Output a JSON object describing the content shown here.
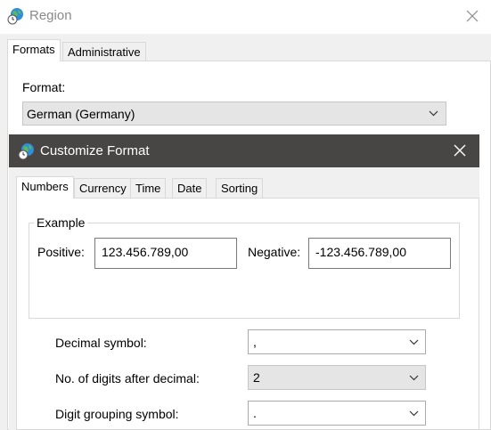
{
  "region": {
    "title": "Region",
    "tabs": [
      {
        "label": "Formats",
        "active": true
      },
      {
        "label": "Administrative",
        "active": false
      }
    ],
    "format_label": "Format:",
    "format_value": "German (Germany)"
  },
  "customize": {
    "title": "Customize Format",
    "tabs": [
      {
        "label": "Numbers",
        "active": true
      },
      {
        "label": "Currency",
        "active": false
      },
      {
        "label": "Time",
        "active": false
      },
      {
        "label": "Date",
        "active": false
      },
      {
        "label": "Sorting",
        "active": false
      }
    ],
    "example": {
      "legend": "Example",
      "positive_label": "Positive:",
      "positive_value": "123.456.789,00",
      "negative_label": "Negative:",
      "negative_value": "-123.456.789,00"
    },
    "settings": [
      {
        "label": "Decimal symbol:",
        "value": ","
      },
      {
        "label": "No. of digits after decimal:",
        "value": "2"
      },
      {
        "label": "Digit grouping symbol:",
        "value": "."
      }
    ]
  },
  "icons": {
    "app": "globe-clock-icon",
    "close": "close-icon",
    "dropdown": "chevron-down-icon"
  },
  "colors": {
    "dialog_titlebar": "#484644",
    "window_bg": "#f0f0f0"
  }
}
